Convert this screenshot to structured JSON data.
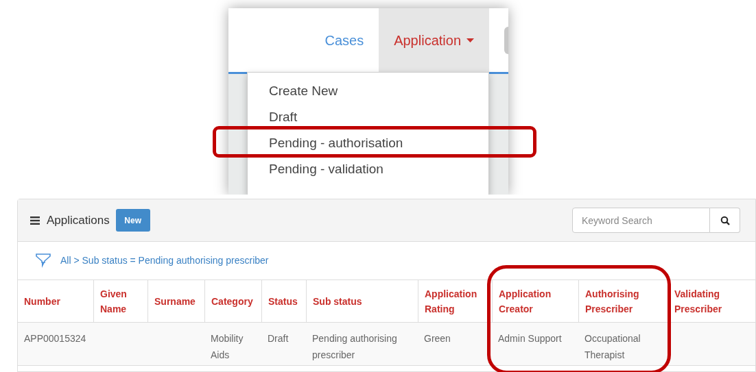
{
  "nav": {
    "tabs": [
      {
        "label": "Cases",
        "selected": false,
        "dropdown": false
      },
      {
        "label": "Application",
        "selected": true,
        "dropdown": true
      }
    ]
  },
  "menu": {
    "items": [
      {
        "label": "Create New",
        "highlighted": false
      },
      {
        "label": "Draft",
        "highlighted": false
      },
      {
        "label": "Pending - authorisation",
        "highlighted": true
      },
      {
        "label": "Pending - validation",
        "highlighted": false
      }
    ]
  },
  "panel": {
    "title": "Applications",
    "new_button": "New",
    "search": {
      "placeholder": "Keyword Search"
    },
    "filter": "All > Sub status = Pending authorising prescriber"
  },
  "table": {
    "columns": [
      {
        "label": "Number",
        "highlighted": false
      },
      {
        "label": "Given Name",
        "highlighted": false
      },
      {
        "label": "Surname",
        "highlighted": false
      },
      {
        "label": "Category",
        "highlighted": false
      },
      {
        "label": "Status",
        "highlighted": false
      },
      {
        "label": "Sub status",
        "highlighted": false
      },
      {
        "label": "Application Rating",
        "highlighted": false
      },
      {
        "label": "Application Creator",
        "highlighted": true
      },
      {
        "label": "Authorising Prescriber",
        "highlighted": true
      },
      {
        "label": "Validating Prescriber",
        "highlighted": false
      }
    ],
    "rows": [
      [
        "APP00015324",
        "",
        "",
        "Mobility Aids",
        "Draft",
        "Pending authorising prescriber",
        "Green",
        "Admin Support",
        "Occupational Therapist",
        ""
      ]
    ]
  }
}
